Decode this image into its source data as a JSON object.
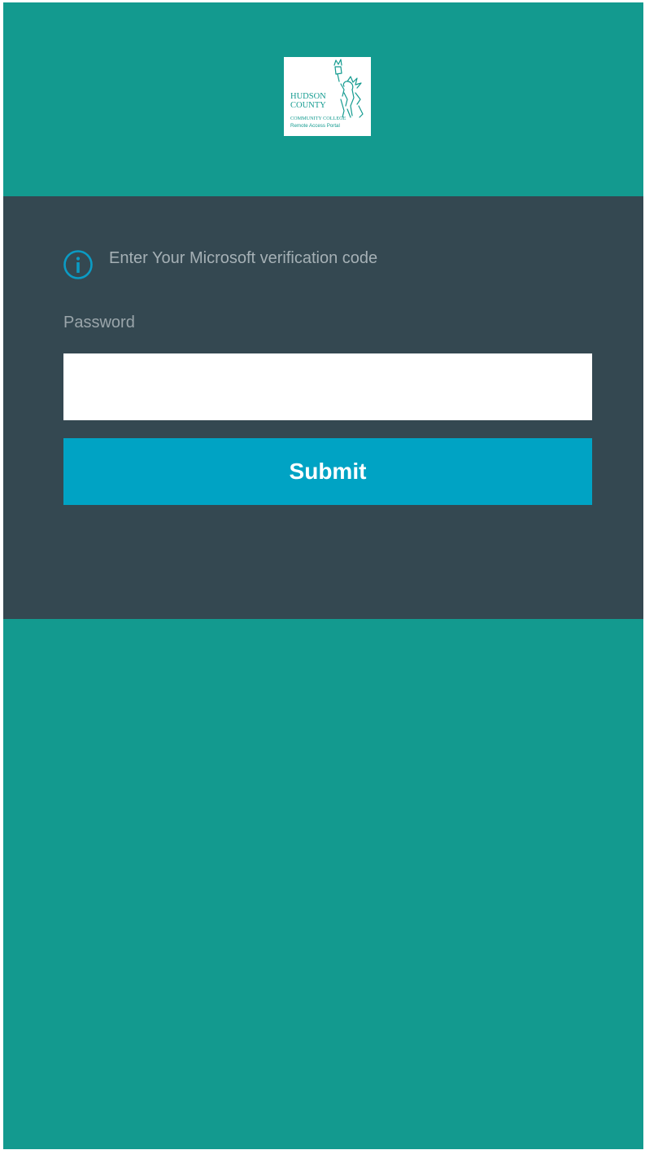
{
  "logo": {
    "line1": "HUDSON",
    "line2": "COUNTY",
    "line3": "COMMUNITY COLLEGE",
    "line4": "Remote Access Portal"
  },
  "form": {
    "info_icon": "info-circle-icon",
    "info_text": "Enter Your Microsoft verification code",
    "password_label": "Password",
    "password_value": "",
    "submit_label": "Submit"
  },
  "colors": {
    "background_teal": "#139a8f",
    "panel_dark": "#344851",
    "button_blue": "#00a3c4",
    "icon_blue": "#0b9bc4"
  }
}
